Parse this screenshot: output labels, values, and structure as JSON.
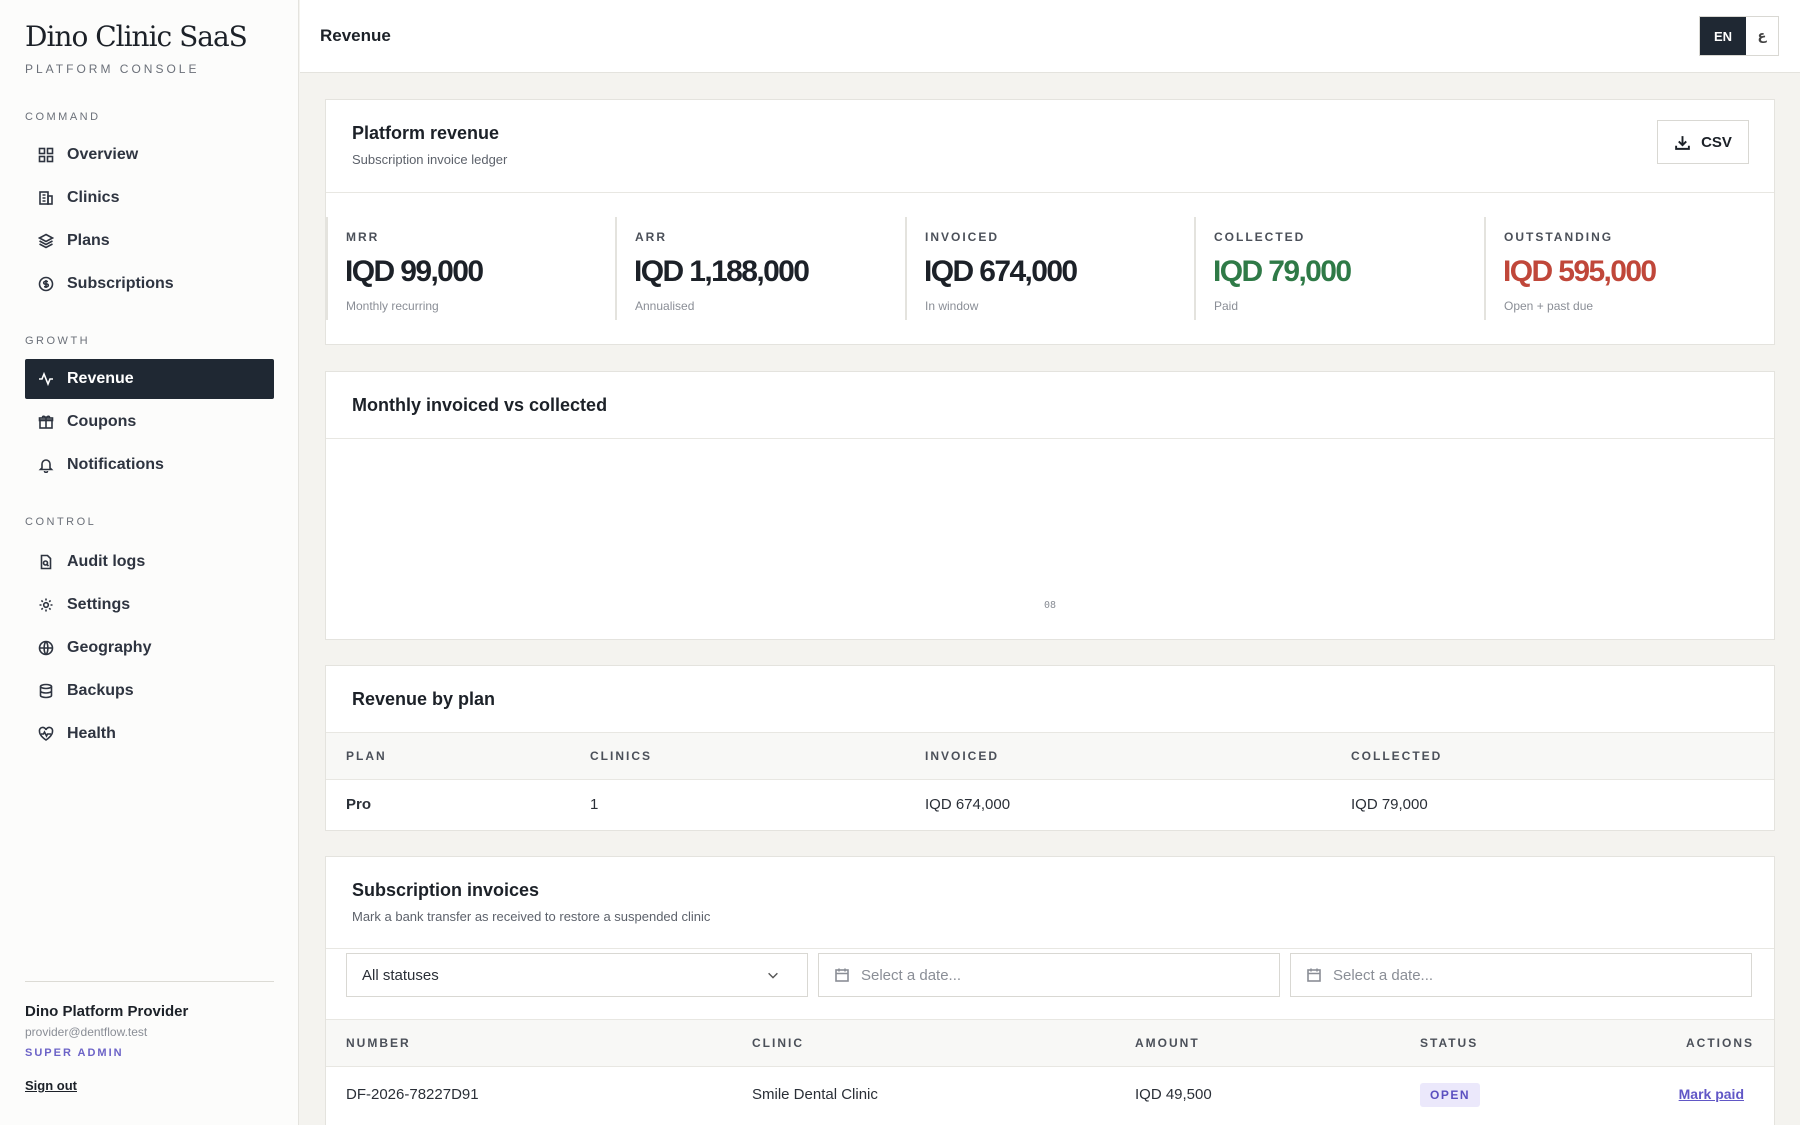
{
  "brand": {
    "title": "Dino Clinic SaaS",
    "subtitle": "PLATFORM CONSOLE"
  },
  "sidebar": {
    "sections": [
      {
        "label": "COMMAND",
        "items": [
          {
            "label": "Overview",
            "icon": "grid-icon"
          },
          {
            "label": "Clinics",
            "icon": "building-icon"
          },
          {
            "label": "Plans",
            "icon": "layers-icon"
          },
          {
            "label": "Subscriptions",
            "icon": "dollar-circle-icon"
          }
        ]
      },
      {
        "label": "GROWTH",
        "items": [
          {
            "label": "Revenue",
            "icon": "activity-icon",
            "active": true
          },
          {
            "label": "Coupons",
            "icon": "gift-icon"
          },
          {
            "label": "Notifications",
            "icon": "bell-icon"
          }
        ]
      },
      {
        "label": "CONTROL",
        "items": [
          {
            "label": "Audit logs",
            "icon": "file-search-icon"
          },
          {
            "label": "Settings",
            "icon": "gear-icon"
          },
          {
            "label": "Geography",
            "icon": "globe-icon"
          },
          {
            "label": "Backups",
            "icon": "database-icon"
          },
          {
            "label": "Health",
            "icon": "heart-pulse-icon"
          }
        ]
      }
    ]
  },
  "user": {
    "name": "Dino Platform Provider",
    "email": "provider@dentflow.test",
    "role": "SUPER ADMIN",
    "signout": "Sign out"
  },
  "header": {
    "title": "Revenue",
    "lang_en": "EN",
    "lang_ar": "ع"
  },
  "summary": {
    "title": "Platform revenue",
    "subtitle": "Subscription invoice ledger",
    "csv_label": "CSV",
    "kpis": [
      {
        "label": "MRR",
        "value": "IQD 99,000",
        "note": "Monthly recurring",
        "color": "#1c2128"
      },
      {
        "label": "ARR",
        "value": "IQD 1,188,000",
        "note": "Annualised",
        "color": "#1c2128"
      },
      {
        "label": "INVOICED",
        "value": "IQD 674,000",
        "note": "In window",
        "color": "#1c2128"
      },
      {
        "label": "COLLECTED",
        "value": "IQD 79,000",
        "note": "Paid",
        "color": "#2f7a47"
      },
      {
        "label": "OUTSTANDING",
        "value": "IQD 595,000",
        "note": "Open + past due",
        "color": "#c0473a"
      }
    ]
  },
  "chart": {
    "title": "Monthly invoiced vs collected"
  },
  "chart_data": {
    "type": "bar",
    "categories": [
      "08"
    ],
    "series": [],
    "title": "Monthly invoiced vs collected",
    "xlabel": "",
    "ylabel": ""
  },
  "by_plan": {
    "title": "Revenue by plan",
    "columns": [
      "PLAN",
      "CLINICS",
      "INVOICED",
      "COLLECTED"
    ],
    "rows": [
      {
        "plan": "Pro",
        "clinics": "1",
        "invoiced": "IQD 674,000",
        "collected": "IQD 79,000"
      }
    ]
  },
  "invoices": {
    "title": "Subscription invoices",
    "subtitle": "Mark a bank transfer as received to restore a suspended clinic",
    "status_filter": "All statuses",
    "date_from_placeholder": "Select a date...",
    "date_to_placeholder": "Select a date...",
    "columns": [
      "NUMBER",
      "CLINIC",
      "AMOUNT",
      "STATUS",
      "ACTIONS"
    ],
    "rows": [
      {
        "number": "DF-2026-78227D91",
        "clinic": "Smile Dental Clinic",
        "amount": "IQD 49,500",
        "status": "OPEN",
        "action": "Mark paid"
      }
    ]
  }
}
